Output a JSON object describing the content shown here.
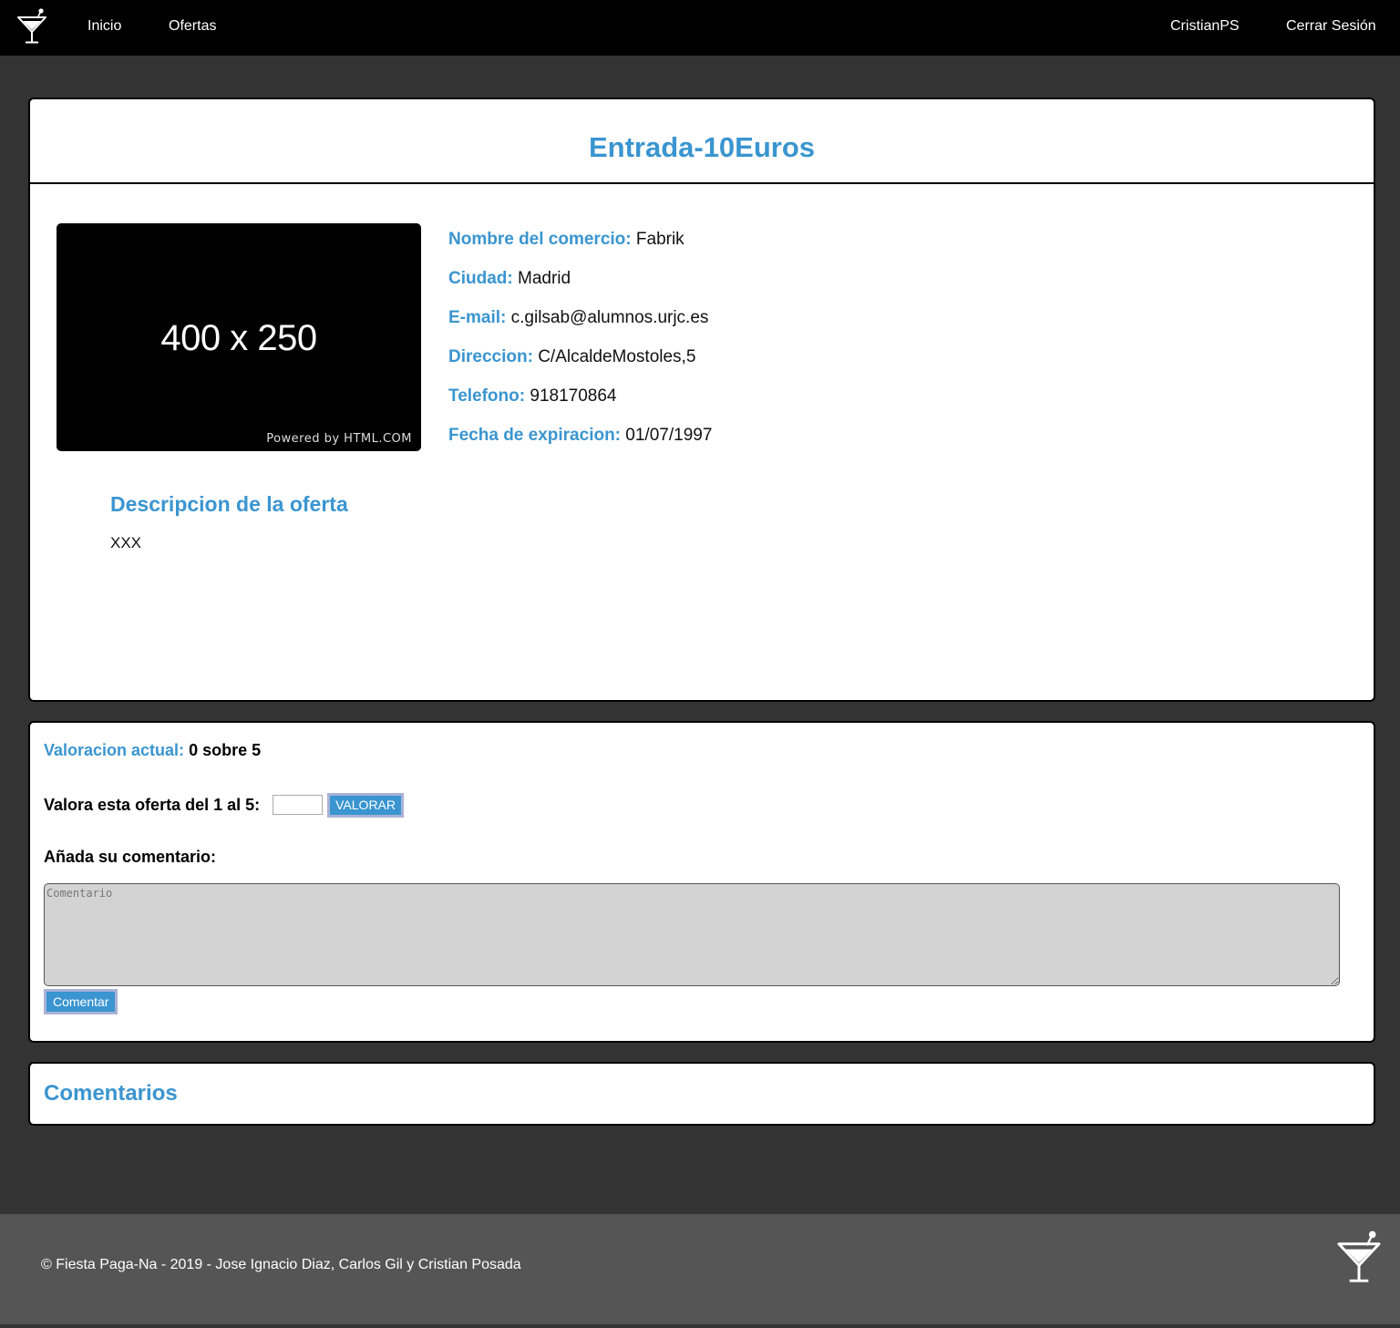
{
  "navbar": {
    "logo_icon": "cocktail-glass-icon",
    "links": [
      "Inicio",
      "Ofertas"
    ],
    "user": "CristianPS",
    "logout": "Cerrar Sesión"
  },
  "offer": {
    "title": "Entrada-10Euros",
    "image": {
      "size_text": "400 x 250",
      "powered_text": "Powered by HTML.COM"
    },
    "fields": [
      {
        "label": "Nombre del comercio:",
        "value": "Fabrik"
      },
      {
        "label": "Ciudad:",
        "value": "Madrid"
      },
      {
        "label": "E-mail:",
        "value": "c.gilsab@alumnos.urjc.es"
      },
      {
        "label": "Direccion:",
        "value": "C/AlcaldeMostoles,5"
      },
      {
        "label": "Telefono:",
        "value": "918170864"
      },
      {
        "label": "Fecha de expiracion:",
        "value": "01/07/1997"
      }
    ],
    "description_title": "Descripcion de la oferta",
    "description_text": "XXX"
  },
  "rating": {
    "current_label": "Valoracion actual:",
    "current_value": "0 sobre 5",
    "rate_label": "Valora esta oferta del 1 al 5:",
    "rate_input_value": "",
    "rate_button": "VALORAR",
    "comment_label": "Añada su comentario:",
    "comment_placeholder": "Comentario",
    "comment_button": "Comentar"
  },
  "comments": {
    "title": "Comentarios"
  },
  "footer": {
    "text": "© Fiesta Paga-Na - 2019 - Jose Ignacio Diaz, Carlos Gil y Cristian Posada",
    "logo_icon": "cocktail-glass-icon"
  },
  "colors": {
    "accent": "#3a95d0",
    "background": "#333333",
    "footer": "#555555",
    "navbar": "#000000"
  }
}
